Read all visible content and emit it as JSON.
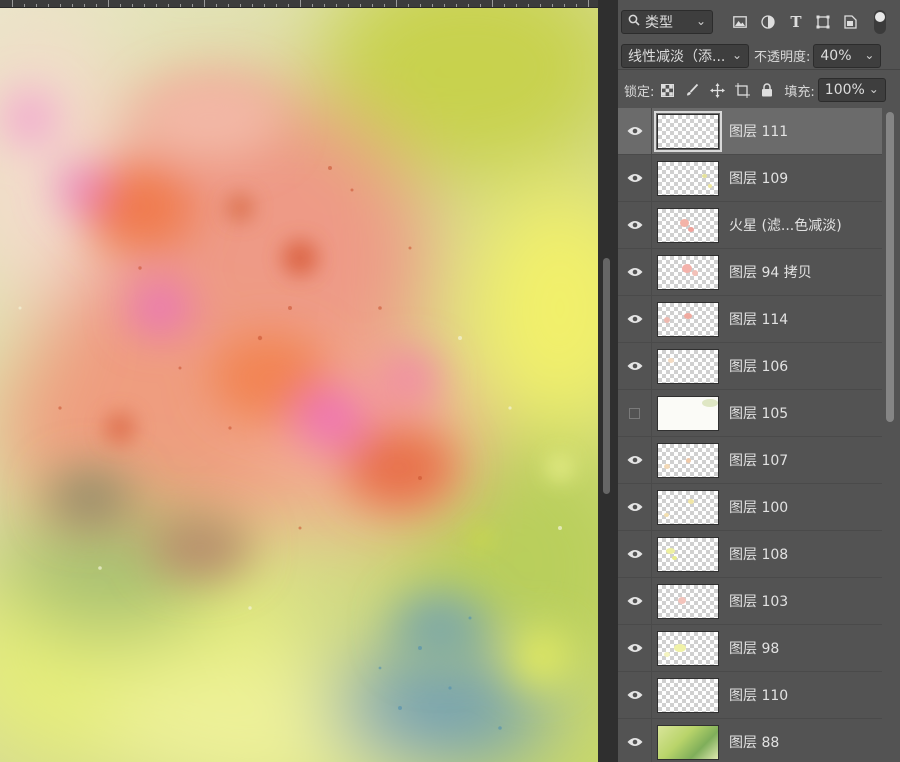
{
  "filter": {
    "kind_label": "类型"
  },
  "blend": {
    "mode": "线性减淡（添...",
    "opacity_label": "不透明度:",
    "opacity_value": "40%"
  },
  "lock": {
    "label": "锁定:",
    "fill_label": "填充:",
    "fill_value": "100%"
  },
  "colors": {
    "panel_bg": "#535353",
    "selected_row": "#6b6b6b",
    "field_bg": "#3e3e3e"
  },
  "icons": {
    "filter": [
      "search-icon",
      "image-filter-icon",
      "adjustment-filter-icon",
      "type-filter-icon",
      "shape-filter-icon",
      "smart-object-filter-icon"
    ],
    "lock": [
      "lock-transparent-pixels-icon",
      "lock-image-pixels-icon",
      "lock-position-icon",
      "lock-artboard-icon",
      "lock-all-icon"
    ]
  },
  "layers": [
    {
      "name": "图层 111",
      "visible": true,
      "selected": true
    },
    {
      "name": "图层 109",
      "visible": true
    },
    {
      "name": "火星 (滤...色减淡)",
      "visible": true
    },
    {
      "name": "图层 94 拷贝",
      "visible": true
    },
    {
      "name": "图层 114",
      "visible": true
    },
    {
      "name": "图层 106",
      "visible": true
    },
    {
      "name": "图层 105",
      "visible": false
    },
    {
      "name": "图层 107",
      "visible": true
    },
    {
      "name": "图层 100",
      "visible": true
    },
    {
      "name": "图层 108",
      "visible": true
    },
    {
      "name": "图层 103",
      "visible": true
    },
    {
      "name": "图层 98",
      "visible": true
    },
    {
      "name": "图层 110",
      "visible": true
    },
    {
      "name": "图层 88",
      "visible": true
    }
  ]
}
